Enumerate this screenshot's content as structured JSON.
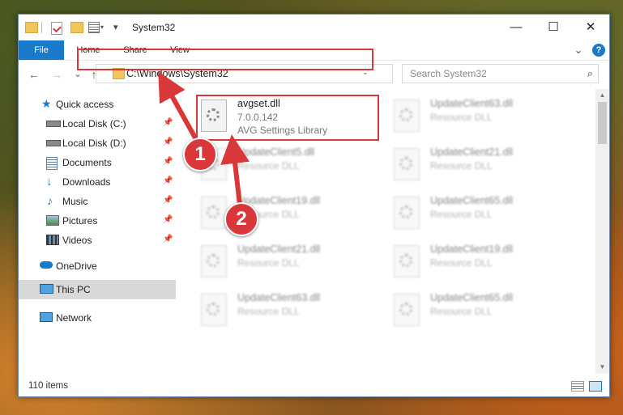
{
  "window": {
    "title": "System32",
    "controls": {
      "minimize": "—",
      "maximize": "☐",
      "close": "✕"
    }
  },
  "ribbon": {
    "tabs": [
      "File",
      "Home",
      "Share",
      "View"
    ],
    "help": "?",
    "expand": "⌄"
  },
  "navigation": {
    "back": "←",
    "forward": "→",
    "recent": "⌄",
    "up": "↑",
    "address": "C:\\Windows\\System32",
    "address_dropdown": "⌄",
    "refresh": "↻",
    "search_placeholder": "Search System32"
  },
  "sidebar": {
    "items": [
      {
        "label": "Quick access",
        "icon": "star-icon",
        "pinned": false
      },
      {
        "label": "Local Disk (C:)",
        "icon": "drive-icon",
        "pinned": true
      },
      {
        "label": "Local Disk (D:)",
        "icon": "drive-icon",
        "pinned": true
      },
      {
        "label": "Documents",
        "icon": "documents-icon",
        "pinned": true
      },
      {
        "label": "Downloads",
        "icon": "downloads-icon",
        "pinned": true
      },
      {
        "label": "Music",
        "icon": "music-icon",
        "pinned": true
      },
      {
        "label": "Pictures",
        "icon": "pictures-icon",
        "pinned": true
      },
      {
        "label": "Videos",
        "icon": "videos-icon",
        "pinned": true
      },
      {
        "label": "OneDrive",
        "icon": "cloud-icon",
        "pinned": false
      },
      {
        "label": "This PC",
        "icon": "computer-icon",
        "pinned": false,
        "selected": true
      },
      {
        "label": "Network",
        "icon": "network-icon",
        "pinned": false
      }
    ],
    "pin_glyph": "📌"
  },
  "files": [
    {
      "name": "avgset.dll",
      "version": "7.0.0.142",
      "description": "AVG Settings Library",
      "highlighted": true
    },
    {
      "name": "UpdateClient63.dll",
      "description": "Resource DLL"
    },
    {
      "name": "UpdateClient5.dll",
      "description": "Resource DLL"
    },
    {
      "name": "UpdateClient21.dll",
      "description": "Resource DLL"
    },
    {
      "name": "UpdateClient19.dll",
      "description": "Resource DLL"
    },
    {
      "name": "UpdateClient65.dll",
      "description": "Resource DLL"
    },
    {
      "name": "UpdateClient21.dll",
      "description": "Resource DLL"
    },
    {
      "name": "UpdateClient19.dll",
      "description": "Resource DLL"
    },
    {
      "name": "UpdateClient63.dll",
      "description": "Resource DLL"
    },
    {
      "name": "UpdateClient65.dll",
      "description": "Resource DLL"
    }
  ],
  "status": {
    "item_count": "110 items"
  },
  "annotations": {
    "step1": "1",
    "step2": "2",
    "color": "#d9373a"
  }
}
